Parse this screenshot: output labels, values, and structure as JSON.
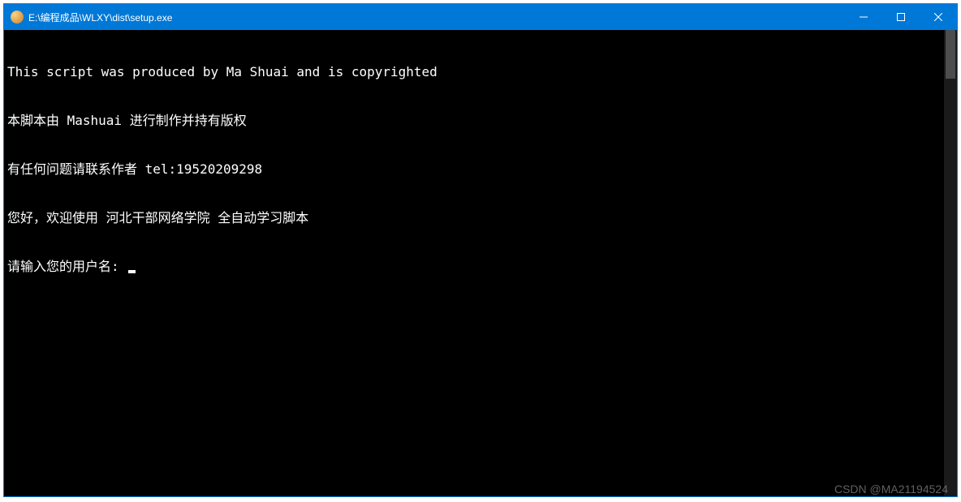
{
  "titlebar": {
    "title": "E:\\编程成品\\WLXY\\dist\\setup.exe"
  },
  "terminal": {
    "lines": [
      "This script was produced by Ma Shuai and is copyrighted",
      "本脚本由 Mashuai 进行制作并持有版权",
      "有任何问题请联系作者 tel:19520209298",
      "您好，欢迎使用 河北干部网络学院 全自动学习脚本"
    ],
    "prompt": "请输入您的用户名: "
  },
  "watermark": "CSDN @MA21194524"
}
